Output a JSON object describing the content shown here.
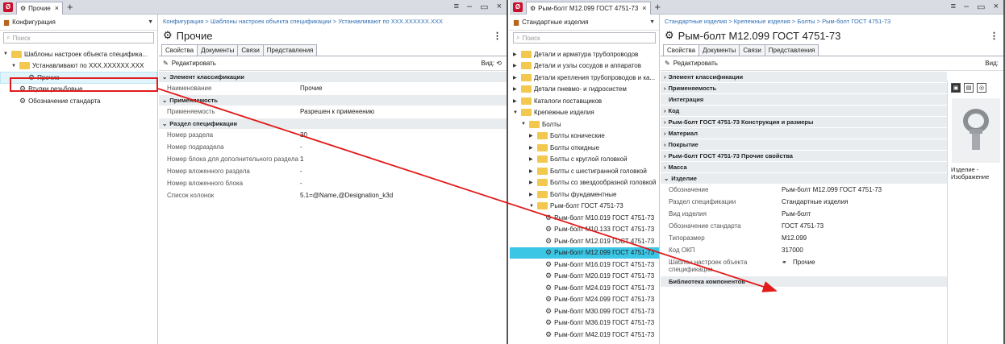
{
  "w1": {
    "tab_title": "Прочие",
    "left": {
      "dropdown": "Конфигурация",
      "search_placeholder": "Поиск",
      "tree": [
        {
          "label": "Шаблоны настроек объекта специфика...",
          "level": 0,
          "kind": "folder",
          "arrow": "▼"
        },
        {
          "label": "Устанавливают по XXX.XXXXXX.XXX",
          "level": 1,
          "kind": "folder",
          "arrow": "▼"
        },
        {
          "label": "Прочие",
          "level": 2,
          "kind": "item",
          "arrow": ""
        },
        {
          "label": "Втулки резьбовые",
          "level": 1,
          "kind": "item",
          "arrow": ""
        },
        {
          "label": "Обозначение стандарта",
          "level": 1,
          "kind": "item",
          "arrow": ""
        }
      ]
    },
    "breadcrumb": "Конфигурация > Шаблоны настроек объекта спецификации > Устанавливают по XXX.XXXXXX.XXX",
    "title": "Прочие",
    "tabs": [
      "Свойства",
      "Документы",
      "Связи",
      "Представления"
    ],
    "edit_label": "Редактировать",
    "view_label": "Вид:",
    "sections": [
      {
        "title": "Элемент классификации",
        "rows": [
          {
            "k": "Наименование",
            "v": "Прочие"
          }
        ]
      },
      {
        "title": "Применяемость",
        "rows": [
          {
            "k": "Применяемость",
            "v": "Разрешен к применению"
          }
        ]
      },
      {
        "title": "Раздел спецификации",
        "rows": [
          {
            "k": "Номер раздела",
            "v": "30"
          },
          {
            "k": "Номер подраздела",
            "v": "-"
          },
          {
            "k": "Номер блока для дополнительного раздела",
            "v": "1"
          },
          {
            "k": "Номер вложенного раздела",
            "v": "-"
          },
          {
            "k": "Номер вложенного блока",
            "v": "-"
          },
          {
            "k": "Список колонок",
            "v": "5.1=@Name,@Designation_k3d"
          }
        ]
      }
    ]
  },
  "w2": {
    "tab_title": "Рым-болт М12.099 ГОСТ 4751-73",
    "left": {
      "dropdown": "Стандартные изделия",
      "search_placeholder": "Поиск",
      "tree": [
        {
          "label": "Детали и арматура трубопроводов",
          "level": 0,
          "kind": "folder",
          "arrow": "▶"
        },
        {
          "label": "Детали и узлы сосудов и аппаратов",
          "level": 0,
          "kind": "folder",
          "arrow": "▶"
        },
        {
          "label": "Детали крепления трубопроводов и ка...",
          "level": 0,
          "kind": "folder",
          "arrow": "▶"
        },
        {
          "label": "Детали пневмо- и гидросистем",
          "level": 0,
          "kind": "folder",
          "arrow": "▶"
        },
        {
          "label": "Каталоги поставщиков",
          "level": 0,
          "kind": "folder",
          "arrow": "▶"
        },
        {
          "label": "Крепежные изделия",
          "level": 0,
          "kind": "folder",
          "arrow": "▼"
        },
        {
          "label": "Болты",
          "level": 1,
          "kind": "folder",
          "arrow": "▼"
        },
        {
          "label": "Болты конические",
          "level": 2,
          "kind": "folder",
          "arrow": "▶"
        },
        {
          "label": "Болты откидные",
          "level": 2,
          "kind": "folder",
          "arrow": "▶"
        },
        {
          "label": "Болты с круглой головкой",
          "level": 2,
          "kind": "folder",
          "arrow": "▶"
        },
        {
          "label": "Болты с шестигранной головкой",
          "level": 2,
          "kind": "folder",
          "arrow": "▶"
        },
        {
          "label": "Болты со звездообразной головкой",
          "level": 2,
          "kind": "folder",
          "arrow": "▶"
        },
        {
          "label": "Болты фундаментные",
          "level": 2,
          "kind": "folder",
          "arrow": "▶"
        },
        {
          "label": "Рым-болт ГОСТ 4751-73",
          "level": 2,
          "kind": "folder",
          "arrow": "▼"
        },
        {
          "label": "Рым-болт М10.019 ГОСТ 4751-73",
          "level": 3,
          "kind": "item",
          "arrow": ""
        },
        {
          "label": "Рым-болт М10.133 ГОСТ 4751-73",
          "level": 3,
          "kind": "item",
          "arrow": ""
        },
        {
          "label": "Рым-болт М12.019 ГОСТ 4751-73",
          "level": 3,
          "kind": "item",
          "arrow": ""
        },
        {
          "label": "Рым-болт М12.099 ГОСТ 4751-73",
          "level": 3,
          "kind": "item",
          "arrow": ""
        },
        {
          "label": "Рым-болт М16.019 ГОСТ 4751-73",
          "level": 3,
          "kind": "item",
          "arrow": ""
        },
        {
          "label": "Рым-болт М20.019 ГОСТ 4751-73",
          "level": 3,
          "kind": "item",
          "arrow": ""
        },
        {
          "label": "Рым-болт М24.019 ГОСТ 4751-73",
          "level": 3,
          "kind": "item",
          "arrow": ""
        },
        {
          "label": "Рым-болт М24.099 ГОСТ 4751-73",
          "level": 3,
          "kind": "item",
          "arrow": ""
        },
        {
          "label": "Рым-болт М30.099 ГОСТ 4751-73",
          "level": 3,
          "kind": "item",
          "arrow": ""
        },
        {
          "label": "Рым-болт М36.019 ГОСТ 4751-73",
          "level": 3,
          "kind": "item",
          "arrow": ""
        },
        {
          "label": "Рым-болт М42.019 ГОСТ 4751-73",
          "level": 3,
          "kind": "item",
          "arrow": ""
        }
      ]
    },
    "breadcrumb": "Стандартные изделия > Крепежные изделия > Болты > Рым-болт ГОСТ 4751-73",
    "title": "Рым-болт М12.099 ГОСТ 4751-73",
    "tabs": [
      "Свойства",
      "Документы",
      "Связи",
      "Представления"
    ],
    "edit_label": "Редактировать",
    "view_label": "Вид:",
    "sections": [
      {
        "title": "Элемент классификации",
        "collapsed": true,
        "rows": []
      },
      {
        "title": "Применяемость",
        "collapsed": true,
        "rows": []
      },
      {
        "title": "Интеграция",
        "collapsed": false,
        "rows": [],
        "noarrow": true
      },
      {
        "title": "Код",
        "collapsed": true,
        "rows": []
      },
      {
        "title": "Рым-болт ГОСТ 4751-73 Конструкция и размеры",
        "collapsed": true,
        "rows": []
      },
      {
        "title": "Материал",
        "collapsed": true,
        "rows": []
      },
      {
        "title": "Покрытие",
        "collapsed": true,
        "rows": []
      },
      {
        "title": "Рым-болт ГОСТ 4751-73 Прочие свойства",
        "collapsed": true,
        "rows": []
      },
      {
        "title": "Масса",
        "collapsed": true,
        "rows": []
      },
      {
        "title": "Изделие",
        "collapsed": false,
        "rows": [
          {
            "k": "Обозначение",
            "v": "Рым-болт М12.099 ГОСТ 4751-73"
          },
          {
            "k": "Раздел спецификации",
            "v": "Стандартные изделия"
          },
          {
            "k": "Вид изделия",
            "v": "Рым-болт"
          },
          {
            "k": "Обозначение стандарта",
            "v": "ГОСТ 4751-73"
          },
          {
            "k": "Типоразмер",
            "v": "М12.099"
          },
          {
            "k": "Код ОКП",
            "v": "317000"
          },
          {
            "k": "Шаблон настроек объекта спецификации",
            "v": "Прочие",
            "link": true
          }
        ]
      },
      {
        "title": "Библиотека компонентов",
        "collapsed": false,
        "rows": [],
        "noarrow": true
      }
    ],
    "preview_caption": "Изделие - Изображение"
  },
  "colors": {
    "selection": "#3cc6e5",
    "accent_red": "#e21a1a",
    "link_blue": "#2f6fb3"
  }
}
